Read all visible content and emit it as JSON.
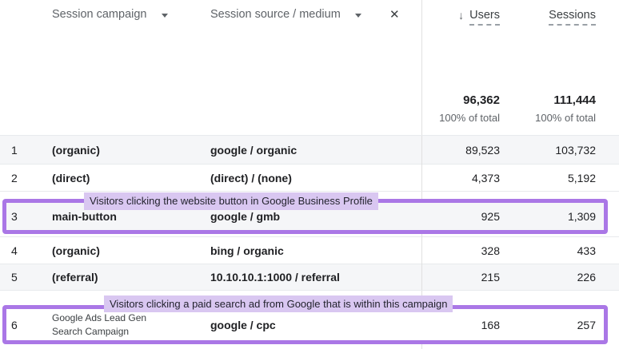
{
  "header": {
    "campaign_picker": "Session campaign",
    "source_picker": "Session source / medium",
    "close_icon": "✕",
    "sort_icon": "↓",
    "users_col": "Users",
    "sessions_col": "Sessions",
    "totals": {
      "users_value": "96,362",
      "users_share": "100% of total",
      "sessions_value": "111,444",
      "sessions_share": "100% of total"
    }
  },
  "rows": [
    {
      "num": "1",
      "campaign": "(organic)",
      "source": "google / organic",
      "users": "89,523",
      "sessions": "103,732"
    },
    {
      "num": "2",
      "campaign": "(direct)",
      "source": "(direct) / (none)",
      "users": "4,373",
      "sessions": "5,192"
    },
    {
      "num": "3",
      "campaign": "main-button",
      "source": "google / gmb",
      "users": "925",
      "sessions": "1,309",
      "annotation": "Visitors clicking the website button in Google Business Profile"
    },
    {
      "num": "4",
      "campaign": "(organic)",
      "source": "bing / organic",
      "users": "328",
      "sessions": "433"
    },
    {
      "num": "5",
      "campaign": "(referral)",
      "source": "10.10.10.1:1000 / referral",
      "users": "215",
      "sessions": "226"
    },
    {
      "num": "6",
      "campaign": "Google  Ads Lead Gen Search Campaign",
      "source": "google / cpc",
      "users": "168",
      "sessions": "257",
      "annotation": "Visitors clicking a paid search ad from Google that is within this campaign"
    }
  ],
  "colors": {
    "highlight_border": "#aa77e6",
    "annotation_background": "#d9c7f1",
    "row_alt_background": "#f5f6f8",
    "divider": "#e0e0e0",
    "text_primary": "#202124",
    "text_secondary": "#5f6368"
  }
}
